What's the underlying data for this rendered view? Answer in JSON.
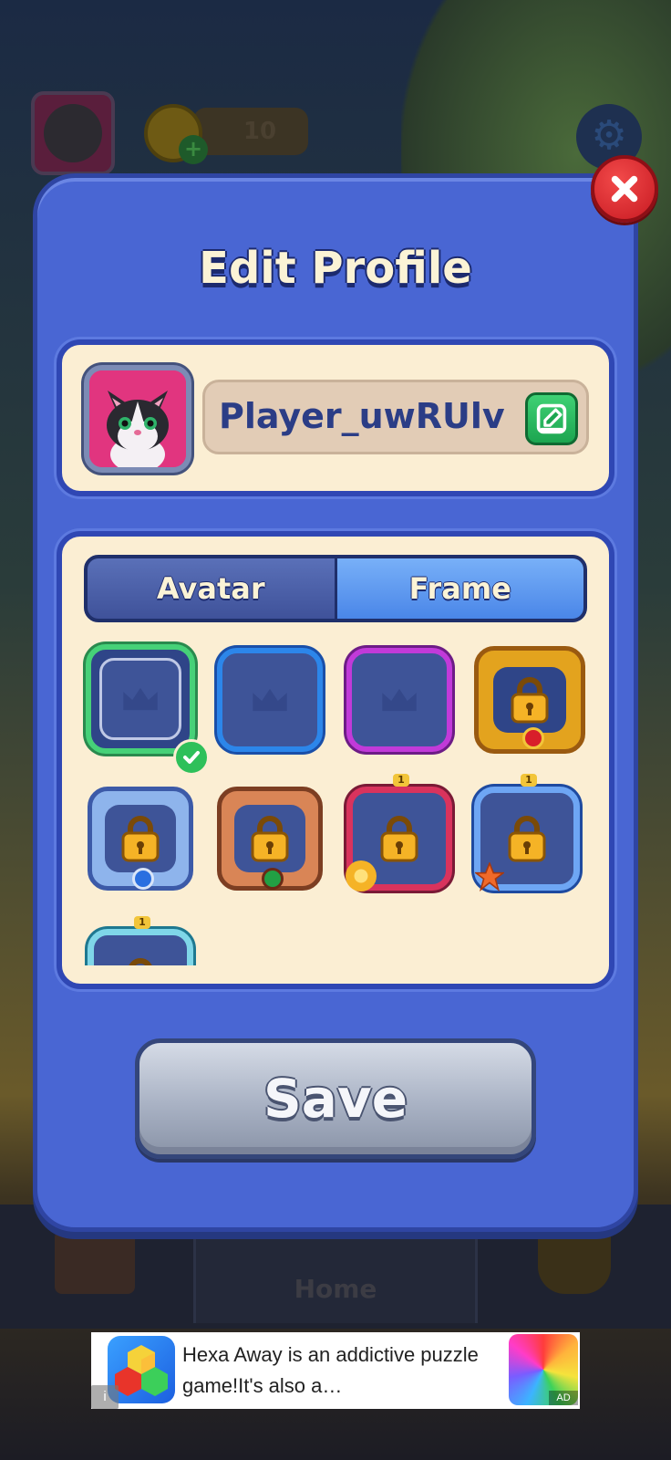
{
  "background": {
    "coin_count": "10",
    "nav_home_label": "Home"
  },
  "dialog": {
    "title": "Edit Profile",
    "player_name": "Player_uwRUlv",
    "tabs": [
      {
        "label": "Avatar",
        "selected": false
      },
      {
        "label": "Frame",
        "selected": true
      }
    ],
    "frames": [
      {
        "style": "green",
        "locked": false,
        "selected": true
      },
      {
        "style": "blue",
        "locked": false,
        "selected": false
      },
      {
        "style": "purple",
        "locked": false,
        "selected": false
      },
      {
        "style": "gold-crown",
        "locked": true,
        "selected": false
      },
      {
        "style": "silver-crown",
        "locked": true,
        "selected": false
      },
      {
        "style": "bronze",
        "locked": true,
        "selected": false
      },
      {
        "style": "red-flower",
        "locked": true,
        "level": "1"
      },
      {
        "style": "blue-starfish",
        "locked": true,
        "level": "1"
      },
      {
        "style": "teal",
        "locked": true,
        "level": "1"
      }
    ],
    "save_label": "Save"
  },
  "ad": {
    "text": "Hexa Away is an addictive puzzle game!It's also a…",
    "tag": "AD",
    "info": "i"
  },
  "colors": {
    "dialog": "#4966d3",
    "card": "#fbeed3",
    "tab_selected": "#4a86e8",
    "edit_green": "#1ca550",
    "close_red": "#c81a22"
  }
}
